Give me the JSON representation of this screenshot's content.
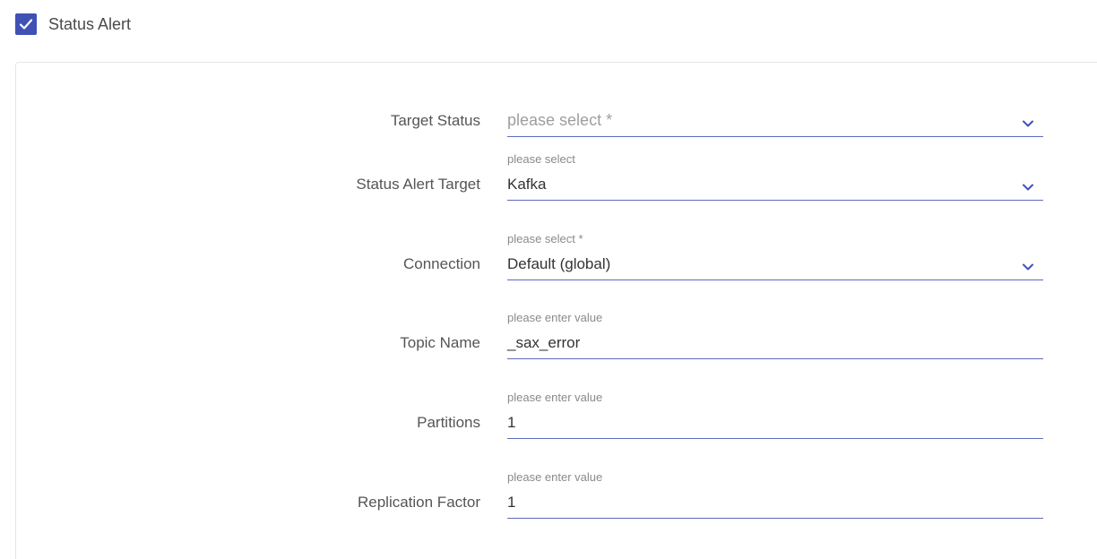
{
  "status_alert": {
    "label": "Status Alert",
    "checked": true
  },
  "form": {
    "target_status": {
      "label": "Target Status",
      "placeholder": "please select *",
      "value": ""
    },
    "status_alert_target": {
      "label": "Status Alert Target",
      "hint": "please select",
      "value": "Kafka"
    },
    "connection": {
      "label": "Connection",
      "hint": "please select *",
      "value": "Default (global)"
    },
    "topic_name": {
      "label": "Topic Name",
      "hint": "please enter value",
      "value": "_sax_error"
    },
    "partitions": {
      "label": "Partitions",
      "hint": "please enter value",
      "value": "1"
    },
    "replication_factor": {
      "label": "Replication Factor",
      "hint": "please enter value",
      "value": "1"
    }
  },
  "colors": {
    "accent": "#3f51b5",
    "underline": "#5c6bc0"
  },
  "icons": {
    "checkbox": "check-icon",
    "dropdown": "chevron-down-icon"
  }
}
